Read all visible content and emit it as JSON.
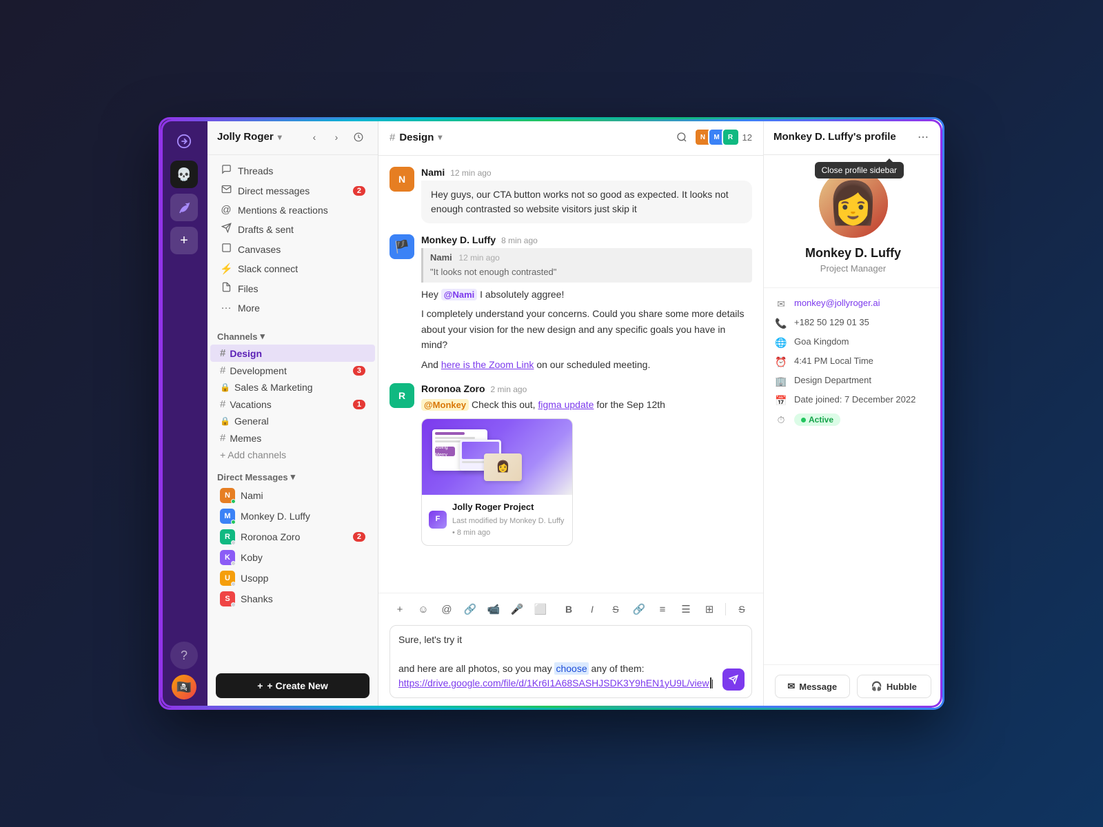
{
  "app": {
    "title": "Jolly Roger"
  },
  "workspace": {
    "name": "Jolly Roger",
    "chevron": "▾"
  },
  "sidebar": {
    "nav_items": [
      {
        "id": "threads",
        "icon": "≡",
        "label": "Threads",
        "badge": null
      },
      {
        "id": "direct-messages-nav",
        "icon": "✉",
        "label": "Direct messages",
        "badge": "2"
      },
      {
        "id": "mentions",
        "icon": "@",
        "label": "Mentions & reactions",
        "badge": null
      },
      {
        "id": "drafts",
        "icon": "✈",
        "label": "Drafts & sent",
        "badge": null
      },
      {
        "id": "canvases",
        "icon": "⬜",
        "label": "Canvases",
        "badge": null
      },
      {
        "id": "slack-connect",
        "icon": "⚡",
        "label": "Slack connect",
        "badge": null
      },
      {
        "id": "files",
        "icon": "📄",
        "label": "Files",
        "badge": null
      },
      {
        "id": "more",
        "icon": "···",
        "label": "More",
        "badge": null
      }
    ],
    "channels_header": "Channels",
    "channels": [
      {
        "id": "design",
        "label": "Design",
        "type": "public",
        "badge": null,
        "active": true
      },
      {
        "id": "development",
        "label": "Development",
        "type": "public",
        "badge": "3"
      },
      {
        "id": "sales-marketing",
        "label": "Sales & Marketing",
        "type": "private",
        "badge": null
      },
      {
        "id": "vacations",
        "label": "Vacations",
        "type": "public",
        "badge": "1"
      },
      {
        "id": "general",
        "label": "General",
        "type": "private",
        "badge": null
      },
      {
        "id": "memes",
        "label": "Memes",
        "type": "public",
        "badge": null
      }
    ],
    "add_channels": "+ Add channels",
    "dm_header": "Direct Messages",
    "dms": [
      {
        "id": "nami",
        "label": "Nami",
        "color": "#e67e22",
        "status": "active"
      },
      {
        "id": "luffy",
        "label": "Monkey D. Luffy",
        "color": "#3b82f6",
        "status": "active"
      },
      {
        "id": "zoro",
        "label": "Roronoa Zoro",
        "color": "#10b981",
        "status": "away",
        "badge": "2"
      },
      {
        "id": "koby",
        "label": "Koby",
        "color": "#8b5cf6",
        "status": "away"
      },
      {
        "id": "usopp",
        "label": "Usopp",
        "color": "#f59e0b",
        "status": "away"
      },
      {
        "id": "shanks",
        "label": "Shanks",
        "color": "#ef4444",
        "status": "away"
      }
    ],
    "create_new": "+ Create New"
  },
  "chat": {
    "channel_name": "Design",
    "member_count": "12",
    "messages": [
      {
        "id": "msg1",
        "author": "Nami",
        "time": "12 min ago",
        "text": "Hey guys, our CTA button works not so good as expected. It looks not enough contrasted so website visitors just skip it",
        "avatar_color": "#e67e22",
        "is_bubble": true
      },
      {
        "id": "msg2",
        "author": "Monkey D. Luffy",
        "time": "8 min ago",
        "avatar_color": "#3b82f6",
        "has_quote": true,
        "quote_author": "Nami",
        "quote_time": "12 min ago",
        "quote_text": "\"It looks not enough contrasted\"",
        "text_part1": "Hey ",
        "mention": "@Nami",
        "text_part2": " I absolutely aggree!",
        "text_part3": "I completely understand your concerns. Could you share some more details about your vision for the new design and any specific goals you have in mind?",
        "text_part4": "And ",
        "link_text": "here is the Zoom Link",
        "text_part5": " on our scheduled meeting."
      },
      {
        "id": "msg3",
        "author": "Roronoa Zoro",
        "time": "2 min ago",
        "avatar_color": "#10b981",
        "mention": "@Monkey",
        "text_part1": " Check this out, ",
        "figma_link": "figma update",
        "text_part2": " for the Sep 12th",
        "figma_card": {
          "title": "Jolly Roger Project",
          "subtitle": "Last modified by Monkey D. Luffy • 8 min ago"
        }
      }
    ],
    "input": {
      "text_before": "Sure, let's try it\n\nand here are all photos, so you may choose any of them: ",
      "link_text": "https://drive.google.com/file/d/1Kr6I1A68SASHJSDK3Y9hEN1yU9L/view",
      "cursor": "|"
    }
  },
  "profile": {
    "title": "Monkey D. Luffy's profile",
    "name": "Monkey D. Luffy",
    "role": "Project Manager",
    "email": "monkey@jollyroger.ai",
    "phone": "+182 50 129 01 35",
    "location": "Goa Kingdom",
    "local_time": "4:41 PM Local Time",
    "department": "Design Department",
    "date_joined": "Date joined: 7 December 2022",
    "status": "Active",
    "action_message": "Message",
    "action_hubble": "Hubble",
    "tooltip": "Close profile sidebar"
  },
  "icons": {
    "back": "‹",
    "forward": "›",
    "history": "⊙",
    "search": "⌕",
    "more": "⋯",
    "hash": "#",
    "chevron_down": "▾",
    "plus": "+",
    "send": "→"
  }
}
